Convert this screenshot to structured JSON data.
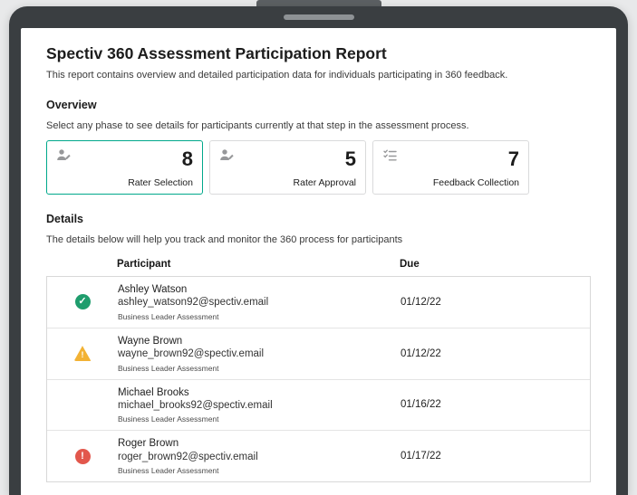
{
  "report": {
    "title": "Spectiv 360 Assessment Participation Report",
    "subtitle": "This report contains overview and detailed participation data for individuals participating in 360 feedback."
  },
  "overview": {
    "heading": "Overview",
    "description": "Select any phase to see details for participants currently at that step in the assessment process.",
    "selected_border_color": "#00a88b",
    "phases": [
      {
        "label": "Rater Selection",
        "count": "8",
        "icon": "person-edit-icon",
        "selected": true
      },
      {
        "label": "Rater Approval",
        "count": "5",
        "icon": "person-edit-icon",
        "selected": false
      },
      {
        "label": "Feedback Collection",
        "count": "7",
        "icon": "checklist-icon",
        "selected": false
      }
    ]
  },
  "details": {
    "heading": "Details",
    "description": "The details below will help you track and monitor the 360 process for participants",
    "table": {
      "columns": {
        "participant": "Participant",
        "due": "Due"
      },
      "status_colors": {
        "complete": "#1f9d6d",
        "warning": "#f2b234",
        "error": "#e2574c"
      },
      "rows": [
        {
          "status": "complete",
          "name": "Ashley Watson",
          "email": "ashley_watson92@spectiv.email",
          "assessment": "Business Leader Assessment",
          "due": "01/12/22"
        },
        {
          "status": "warning",
          "name": "Wayne Brown",
          "email": "wayne_brown92@spectiv.email",
          "assessment": "Business Leader Assessment",
          "due": "01/12/22"
        },
        {
          "status": "none",
          "name": "Michael Brooks",
          "email": "michael_brooks92@spectiv.email",
          "assessment": "Business Leader Assessment",
          "due": "01/16/22"
        },
        {
          "status": "error",
          "name": "Roger Brown",
          "email": "roger_brown92@spectiv.email",
          "assessment": "Business Leader Assessment",
          "due": "01/17/22"
        }
      ]
    }
  }
}
